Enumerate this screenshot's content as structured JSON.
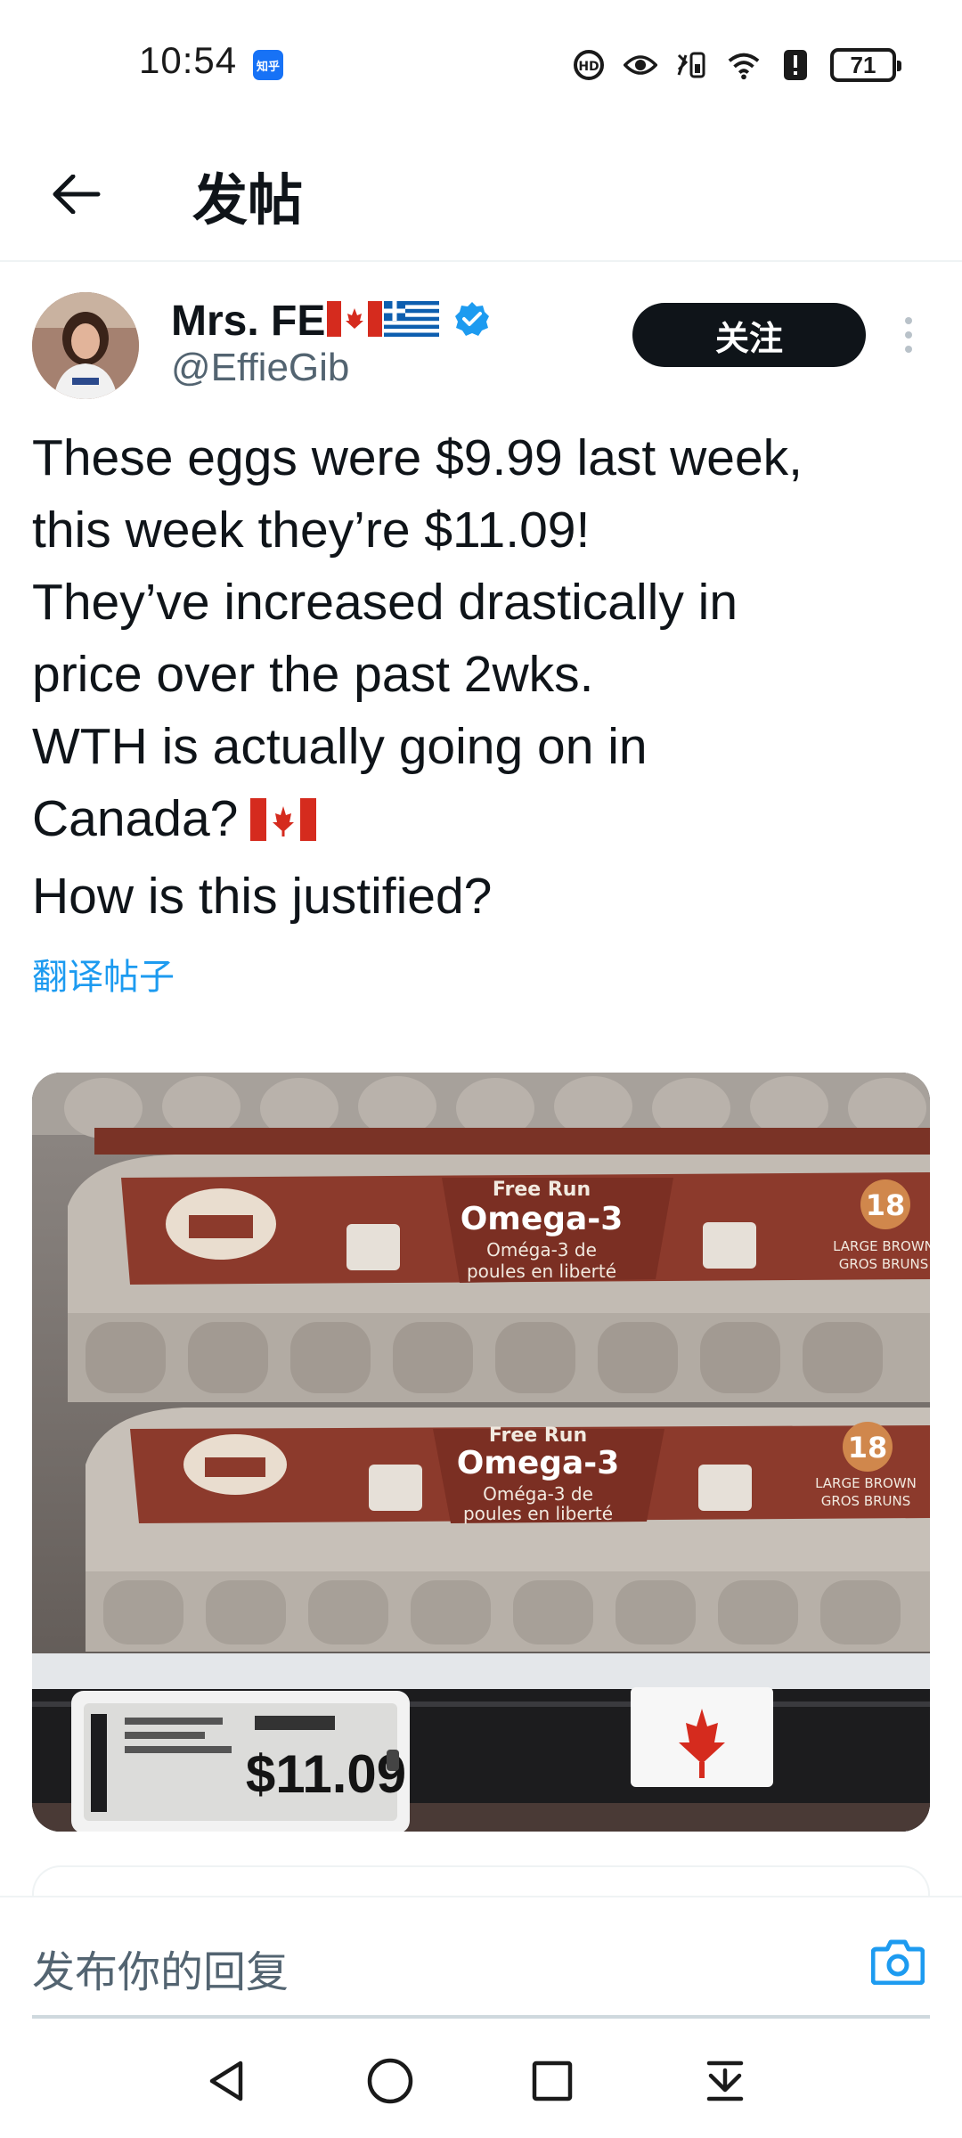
{
  "status_bar": {
    "time": "10:54",
    "app_badge": "知乎",
    "battery": "71",
    "icons": [
      "hd-call-icon",
      "eye-icon",
      "vibrate-icon",
      "wifi-icon",
      "alert-icon",
      "battery-icon"
    ]
  },
  "header": {
    "title": "发帖"
  },
  "post": {
    "author": {
      "name": "Mrs. FE",
      "flags": [
        "canada-flag",
        "greece-flag"
      ],
      "handle": "@EffieGib",
      "verified": true
    },
    "follow_label": "关注",
    "text_lines": [
      "These eggs were $9.99 last week,",
      "this week they’re $11.09!",
      "They’ve increased drastically in",
      "price over the past 2wks.",
      "WTH is actually going on in",
      "Canada?",
      "How is this justified?"
    ],
    "translate_label": "翻译帖子",
    "image": {
      "carton_label_line1": "Free Run",
      "carton_label_line2": "Omega-3",
      "carton_label_line3": "Oméga-3 de",
      "carton_label_line4": "poules en liberté",
      "carton_count": "18",
      "carton_size_line1": "LARGE BROWN",
      "carton_size_line2": "GROS BRUNS",
      "price_tag": "$11.09"
    }
  },
  "reply": {
    "placeholder": "发布你的回复"
  },
  "nav": [
    "back-nav-icon",
    "home-nav-icon",
    "recents-nav-icon",
    "notification-pull-icon"
  ],
  "colors": {
    "accent": "#1d9bf0",
    "text_primary": "#0f1419",
    "text_secondary": "#536471",
    "follow_bg": "#0f1419",
    "carton_red": "#8c3a2c",
    "canada_red": "#d52b1e"
  }
}
